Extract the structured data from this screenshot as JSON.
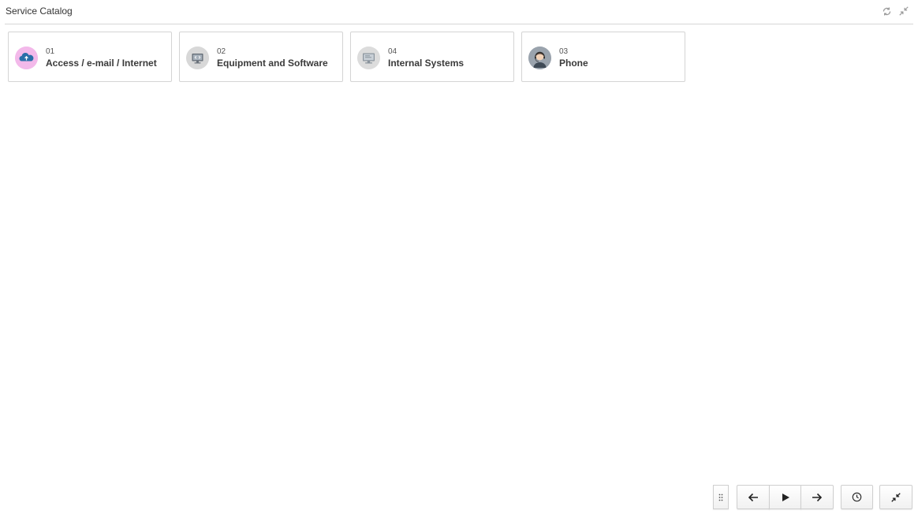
{
  "header": {
    "title": "Service Catalog",
    "refresh_icon": "refresh-icon",
    "collapse_icon": "collapse-icon"
  },
  "cards": [
    {
      "number": "01",
      "label": "Access / e-mail / Internet",
      "icon": "cloud-icon",
      "icon_bg": "#f3b9ea"
    },
    {
      "number": "02",
      "label": "Equipment and Software",
      "icon": "monitor-icon",
      "icon_bg": "#d8d8d8"
    },
    {
      "number": "04",
      "label": "Internal Systems",
      "icon": "computer-icon",
      "icon_bg": "#dcdcdc"
    },
    {
      "number": "03",
      "label": "Phone",
      "icon": "support-agent-icon",
      "icon_bg": "#9aa3ad"
    }
  ],
  "bottom_controls": {
    "drag_icon": "drag-handle-icon",
    "back_icon": "arrow-left-icon",
    "play_icon": "play-icon",
    "forward_icon": "arrow-right-icon",
    "history_icon": "clock-icon",
    "minimize_icon": "minimize-icon"
  }
}
